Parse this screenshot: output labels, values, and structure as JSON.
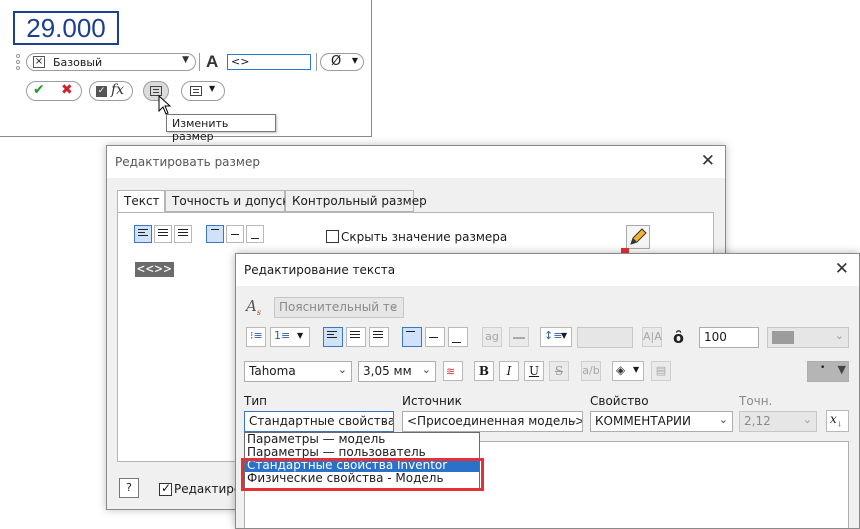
{
  "mini_toolbar": {
    "dimension_value": "29.000",
    "style": "Базовый",
    "text_input": "<>",
    "font_icon": "A",
    "diameter_icon": "Ø",
    "fx_label": "fx",
    "tooltip": "Изменить размер"
  },
  "edit_dimension_dialog": {
    "title": "Редактировать размер",
    "tabs": [
      "Текст",
      "Точность и допуск",
      "Контрольный размер"
    ],
    "hide_value_label": "Скрыть значение размера",
    "placeholder_tag": "<<>>",
    "bottom_checkbox_label": "Редактиро"
  },
  "text_dialog": {
    "title": "Редактирование текста",
    "style_combo": "Пояснительный те",
    "font": "Tahoma",
    "size": "3,05 мм",
    "width_scale": "100",
    "labels": {
      "type": "Тип",
      "source": "Источник",
      "property": "Свойство",
      "precision": "Точн."
    },
    "type_value": "Стандартные свойства",
    "source_value": "<Присоединенная модель>",
    "property_value": "КОММЕНТАРИИ",
    "precision_value": "2,12",
    "bold": "B",
    "italic": "I",
    "underline": "U",
    "strike": "S",
    "dropdown_options": [
      "Параметры — модель",
      "Параметры — пользователь",
      "Стандартные свойства Inventor",
      "Физические свойства - Модель"
    ],
    "selected_option": "Стандартные свойства Inventor"
  },
  "colors": {
    "accent": "#2a72c9",
    "highlight_box": "#e53035",
    "arrow": "#e53035",
    "dimension_text": "#1d3f8f"
  }
}
